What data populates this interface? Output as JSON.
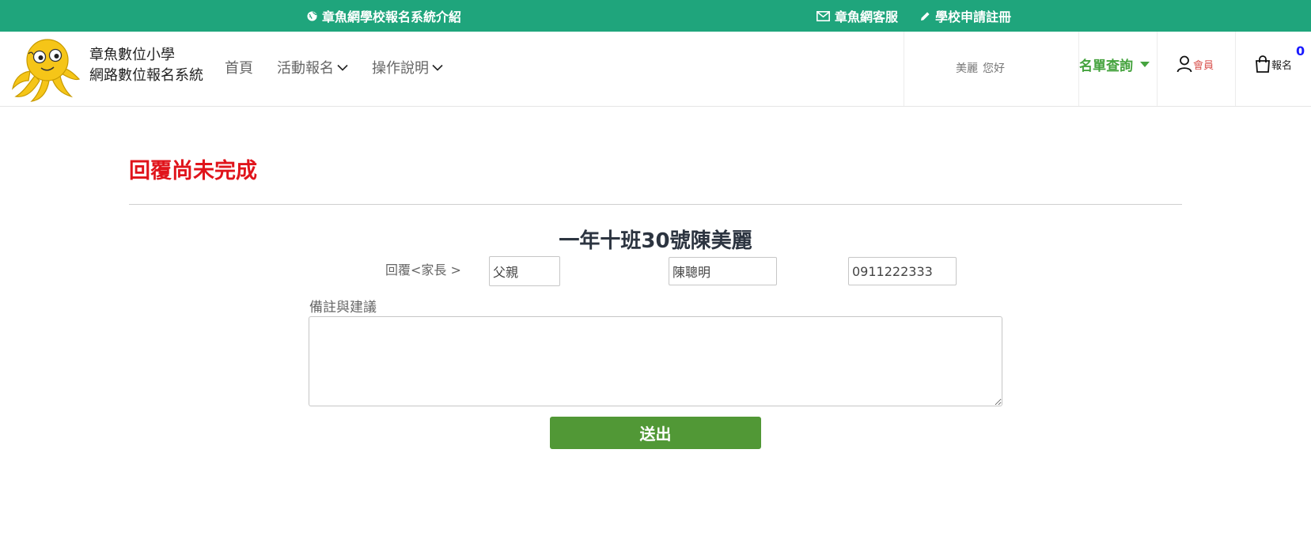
{
  "topbar": {
    "intro_link": "章魚網學校報名系統介紹",
    "service_link": "章魚網客服",
    "apply_link": "學校申請註冊"
  },
  "brand": {
    "line1": "章魚數位小學",
    "line2": "網路數位報名系統"
  },
  "nav": {
    "home": "首頁",
    "activities": "活動報名",
    "guide": "操作說明"
  },
  "user": {
    "name": "美麗",
    "greeting": "您好"
  },
  "header_actions": {
    "roster": "名單查詢",
    "member": "會員",
    "cart": "報名",
    "cart_count": "0"
  },
  "page": {
    "status_title": "回覆尚未完成",
    "student": "一年十班30號陳美麗",
    "reply_label": "回覆<家長 >",
    "relation_value": "父親",
    "parent_name_value": "陳聰明",
    "phone_value": "0911222333",
    "notes_label": "備註與建議",
    "notes_value": "",
    "submit_label": "送出"
  },
  "colors": {
    "topbar": "#1fa57c",
    "status_red": "#e0141b",
    "roster_green": "#45a33e",
    "submit_green": "#519836",
    "cart_count_blue": "#1a1aff"
  }
}
